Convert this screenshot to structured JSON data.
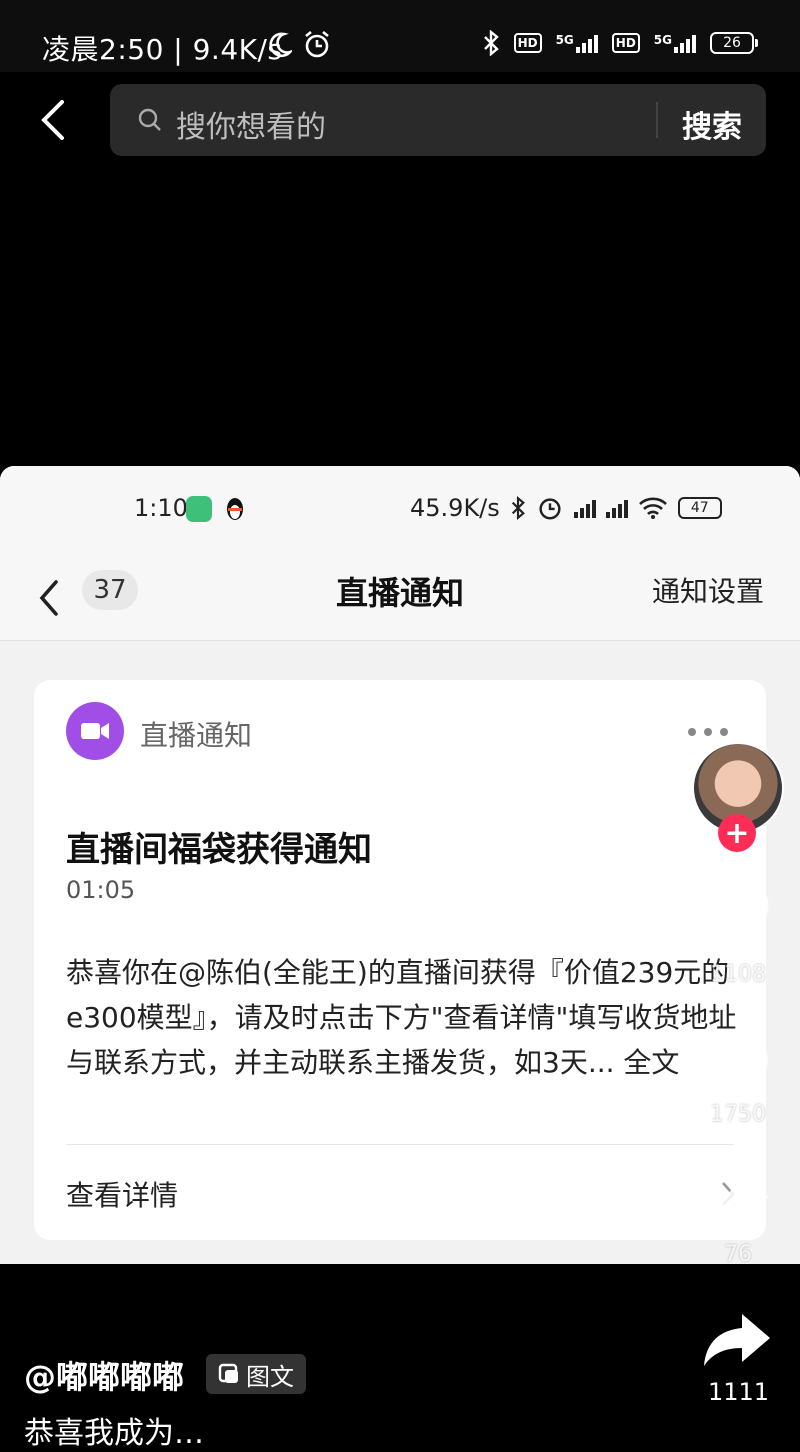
{
  "status_bar": {
    "time": "凌晨2:50 | 9.4K/s",
    "network1": "5G",
    "network2": "5G",
    "hd1": "HD",
    "hd2": "HD",
    "battery": "26"
  },
  "search": {
    "placeholder": "搜你想看的",
    "button": "搜索"
  },
  "embedded": {
    "status": {
      "time": "1:10",
      "speed": "45.9K/s",
      "battery": "47"
    },
    "nav": {
      "count": "37",
      "title": "直播通知",
      "settings": "通知设置"
    },
    "card": {
      "source": "直播通知",
      "title": "直播间福袋获得通知",
      "time": "01:05",
      "body": "恭喜你在@陈伯(全能王)的直播间获得『价值239元的e300模型』，请及时点击下方\"查看详情\"填写收货地址与联系方式，并主动联系主播发货，如3天... 全文",
      "link": "查看详情"
    }
  },
  "rail": {
    "like_count": "1108",
    "comment_count": "1750",
    "favorite_count": "76",
    "share_count": "1111",
    "follow_symbol": "+"
  },
  "post": {
    "author": "@嘟嘟嘟嘟",
    "tag": "图文",
    "caption": "恭喜我成为…"
  }
}
